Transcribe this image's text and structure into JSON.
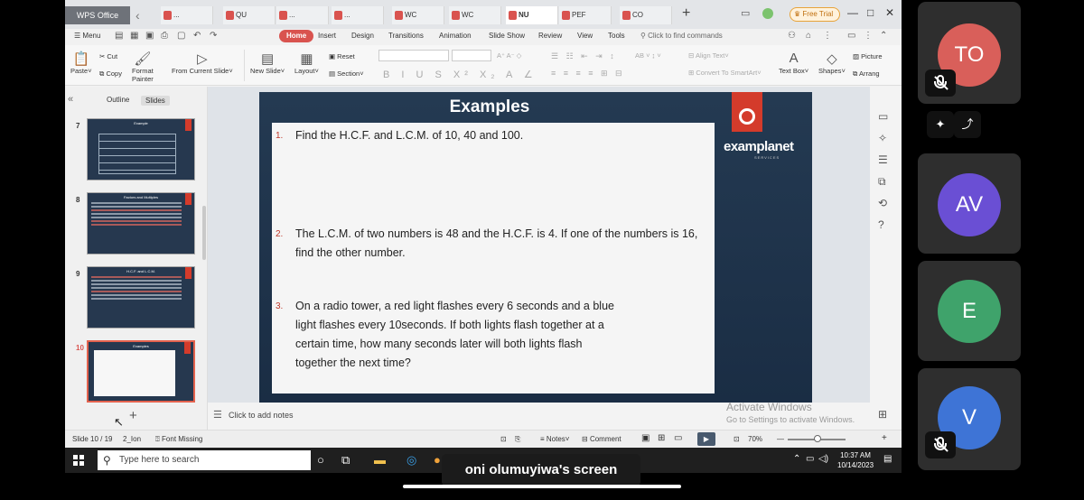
{
  "window": {
    "brand": "WPS Office",
    "tabs": [
      {
        "label": "...",
        "color": "#d9534f"
      },
      {
        "label": "QU",
        "color": "#d9534f"
      },
      {
        "label": "...",
        "color": "#d9534f"
      },
      {
        "label": "...",
        "color": "#d9534f"
      },
      {
        "label": "WC",
        "color": "#d9534f"
      },
      {
        "label": "WC",
        "color": "#d9534f"
      },
      {
        "label": "NU",
        "color": "#d9534f",
        "active": true
      },
      {
        "label": "PEF",
        "color": "#d9534f"
      },
      {
        "label": "CO",
        "color": "#d9534f"
      }
    ],
    "free_trial": "Free Trial"
  },
  "menu": {
    "main": "Menu",
    "items": [
      "Home",
      "Insert",
      "Design",
      "Transitions",
      "Animation",
      "Slide Show",
      "Review",
      "View",
      "Tools"
    ],
    "active": "Home",
    "search": "Click to find commands"
  },
  "toolbar": {
    "cut": "Cut",
    "copy": "Copy",
    "paste": "Paste",
    "format_painter_1": "Format",
    "format_painter_2": "Painter",
    "from_current_slide": "From Current Slide",
    "new_slide": "New Slide",
    "layout": "Layout",
    "reset": "Reset",
    "section": "Section",
    "align_text": "Align Text",
    "convert_smartart": "Convert To SmartArt",
    "text_box": "Text Box",
    "shapes": "Shapes",
    "picture": "Picture",
    "arrange": "Arrang"
  },
  "panel": {
    "outline_tab": "Outline",
    "slides_tab": "Slides",
    "thumbnails": [
      {
        "number": "7",
        "title": "Example"
      },
      {
        "number": "8",
        "title": "Factors and Multiples"
      },
      {
        "number": "9",
        "title": "H.C.F. and L.C.M."
      },
      {
        "number": "10",
        "title": "Examples",
        "active": true
      }
    ]
  },
  "slide": {
    "title": "Examples",
    "questions": [
      {
        "num": "1.",
        "lines": [
          "Find the H.C.F. and L.C.M. of 10, 40 and 100."
        ]
      },
      {
        "num": "2.",
        "lines": [
          "The L.C.M. of two numbers is 48 and the H.C.F. is 4. If one of the numbers is 16,",
          "find the other number."
        ]
      },
      {
        "num": "3.",
        "lines": [
          "On a radio tower, a red light flashes every 6 seconds and a blue",
          "light flashes every 10seconds. If both lights flash together at a",
          "certain time, how many seconds later will both lights flash",
          "together the next time?"
        ]
      }
    ],
    "logo_text": "examplanet",
    "logo_sub": "SERVICES"
  },
  "notes": {
    "placeholder": "Click to add notes"
  },
  "activation": {
    "line1": "Activate Windows",
    "line2": "Go to Settings to activate Windows."
  },
  "status": {
    "slide_counter": "Slide 10 / 19",
    "theme": "2_Ion",
    "font_missing": "Font Missing",
    "notes": "Notes",
    "comment": "Comment",
    "zoom": "70%"
  },
  "taskbar": {
    "search_placeholder": "Type here to search",
    "time": "10:37 AM",
    "date": "10/14/2023"
  },
  "meeting": {
    "screen_banner": "oni olumuyiwa's screen",
    "participants": [
      {
        "initials": "TO",
        "color": "#d95f5a",
        "muted": true
      },
      {
        "initials": "AV",
        "color": "#6a4fd4",
        "muted": false
      },
      {
        "initials": "E",
        "color": "#3fa36b",
        "muted": false
      },
      {
        "initials": "V",
        "color": "#3e74d6",
        "muted": true
      }
    ]
  }
}
